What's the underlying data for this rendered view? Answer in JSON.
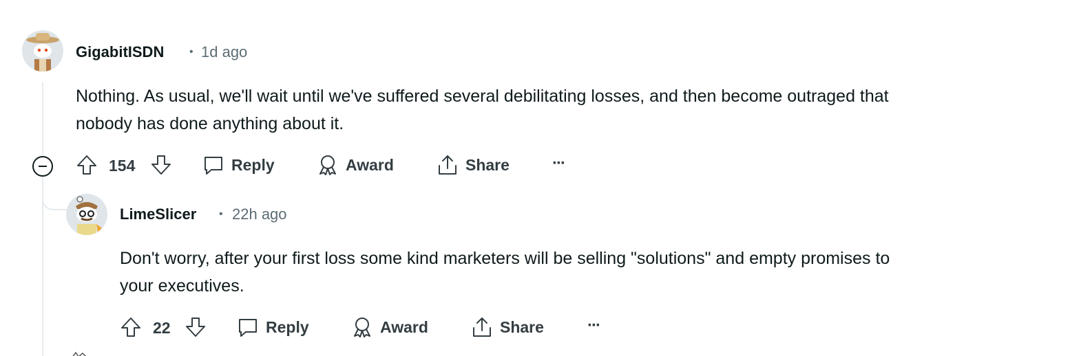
{
  "comments": [
    {
      "username": "GigabitISDN",
      "separator": "•",
      "time": "1d ago",
      "body_lines": [
        "Nothing. As usual, we'll wait until we've suffered several debilitating losses, and then become outraged that",
        "nobody has done anything about it."
      ],
      "votes": "154",
      "reply_label": "Reply",
      "award_label": "Award",
      "share_label": "Share",
      "more_label": "···"
    },
    {
      "username": "LimeSlicer",
      "separator": "•",
      "time": "22h ago",
      "body_lines": [
        "Don't worry, after your first loss some kind marketers will be selling \"solutions\" and empty promises to",
        "your executives."
      ],
      "votes": "22",
      "reply_label": "Reply",
      "award_label": "Award",
      "share_label": "Share",
      "more_label": "···"
    }
  ],
  "icons": {
    "collapse": "collapse-minus-icon",
    "upvote": "upvote-arrow-icon",
    "downvote": "downvote-arrow-icon",
    "reply": "speech-bubble-icon",
    "award": "award-ribbon-icon",
    "share": "share-upload-icon",
    "more": "ellipsis-icon"
  }
}
